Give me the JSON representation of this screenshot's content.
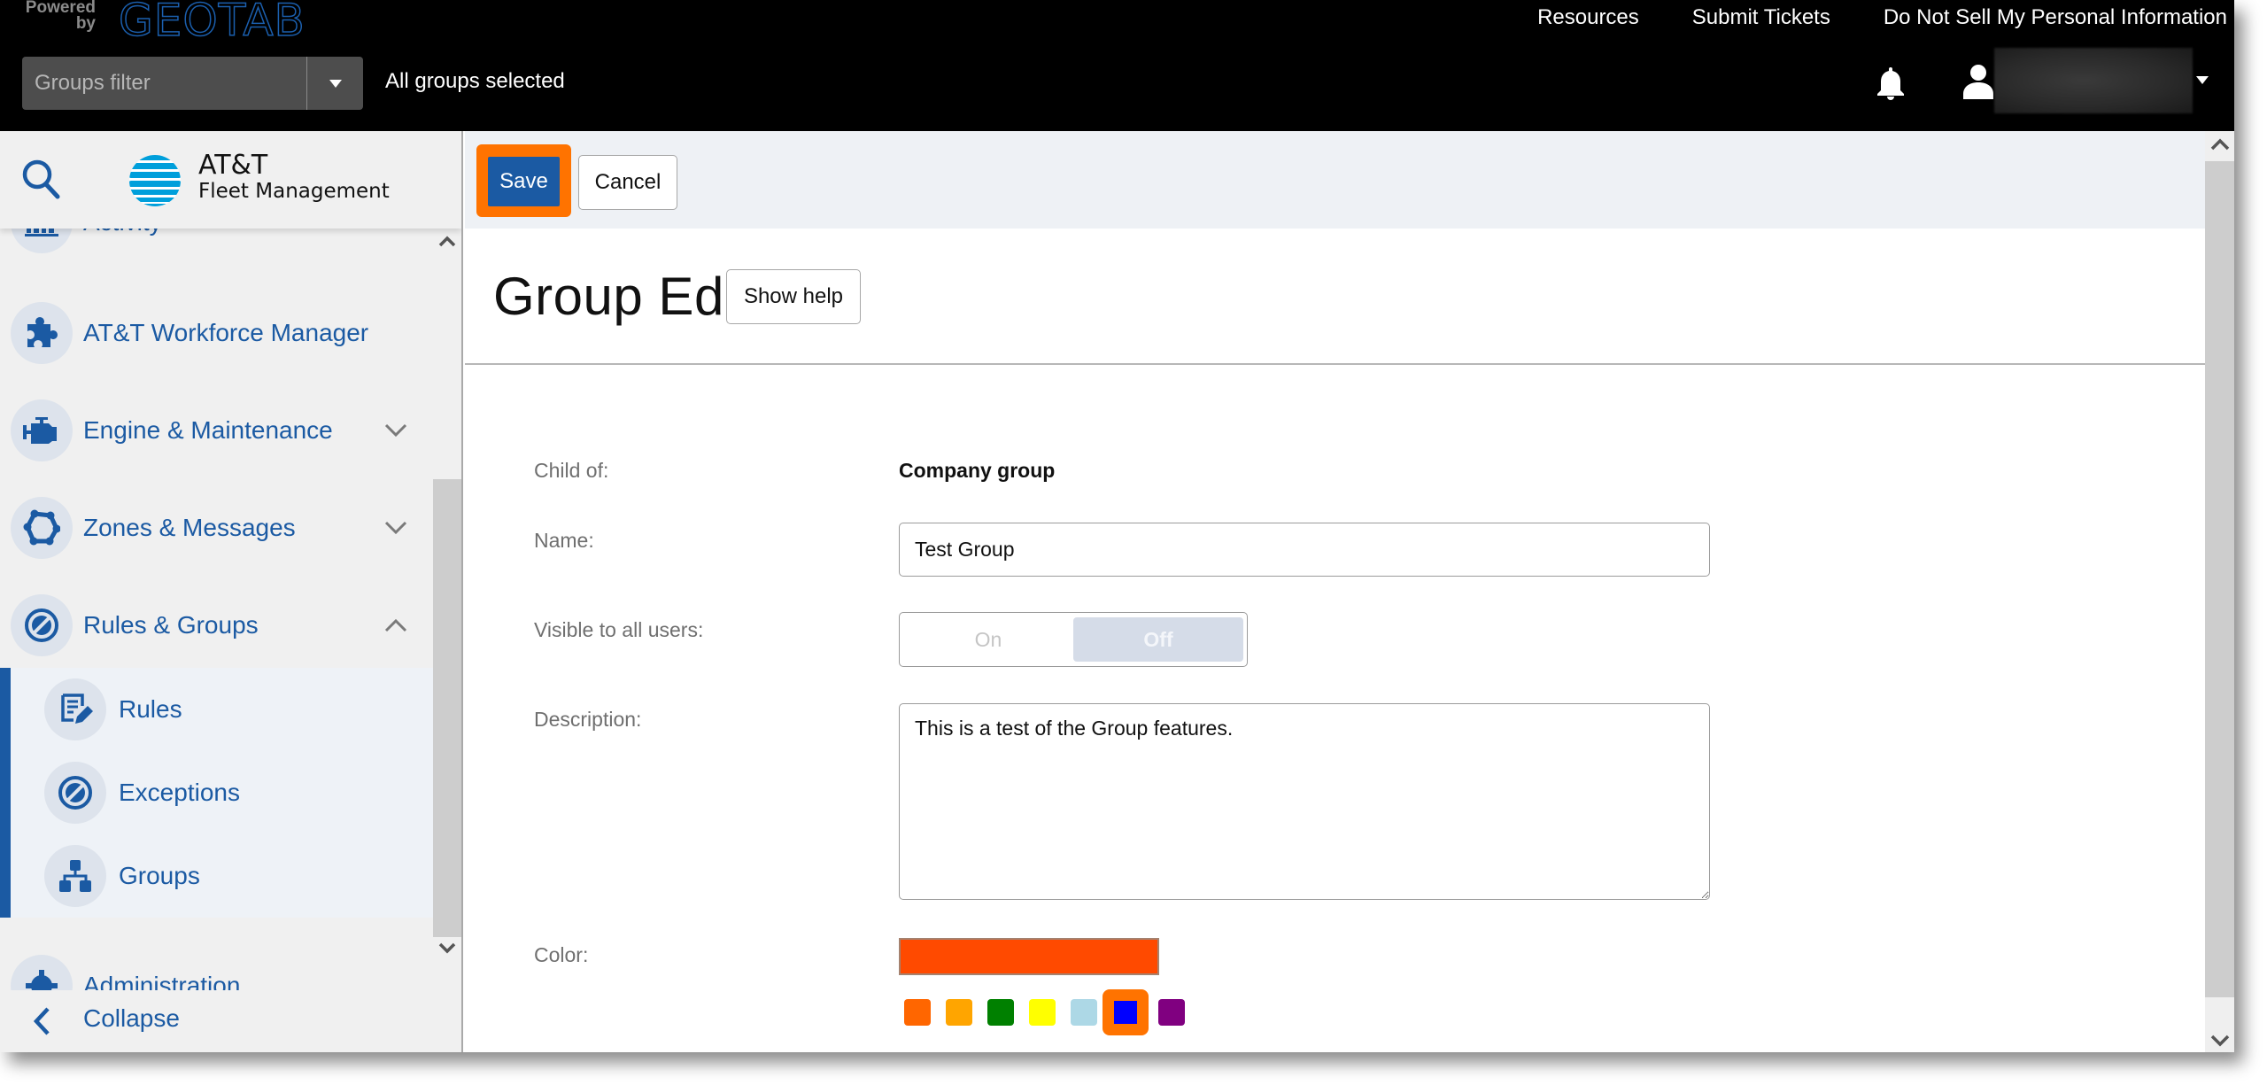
{
  "header": {
    "powered_by_line1": "Powered",
    "powered_by_line2": "by",
    "brand": "GEOTAB",
    "links": [
      "Resources",
      "Submit Tickets",
      "Do Not Sell My Personal Information"
    ],
    "groups_filter_placeholder": "Groups filter",
    "groups_selected_text": "All groups selected",
    "icons": {
      "notifications": "bell-icon",
      "user": "user-icon",
      "user_menu": "caret-down-icon"
    }
  },
  "sidebar": {
    "logo_line1": "AT&T",
    "logo_line2": "Fleet Management",
    "items": [
      {
        "label": "Activity",
        "icon": "bar-chart-icon",
        "expanded": false
      },
      {
        "label": "AT&T Workforce Manager",
        "icon": "puzzle-icon"
      },
      {
        "label": "Engine & Maintenance",
        "icon": "engine-icon",
        "expanded": false
      },
      {
        "label": "Zones & Messages",
        "icon": "zones-icon",
        "expanded": false
      },
      {
        "label": "Rules & Groups",
        "icon": "rules-icon",
        "expanded": true,
        "children": [
          {
            "label": "Rules",
            "icon": "rules-edit-icon"
          },
          {
            "label": "Exceptions",
            "icon": "exceptions-icon"
          },
          {
            "label": "Groups",
            "icon": "groups-icon"
          }
        ]
      },
      {
        "label": "Administration",
        "icon": "gear-icon",
        "expanded": false
      }
    ],
    "collapse_label": "Collapse"
  },
  "toolbar": {
    "save_label": "Save",
    "cancel_label": "Cancel"
  },
  "page": {
    "title": "Group Edit",
    "help_label": "Show help"
  },
  "form": {
    "child_of_label": "Child of:",
    "child_of_value": "Company group",
    "name_label": "Name:",
    "name_value": "Test Group",
    "visible_label": "Visible to all users:",
    "visible_on": "On",
    "visible_off": "Off",
    "visible_selected": "Off",
    "description_label": "Description:",
    "description_value": "This is a test of the Group features.",
    "color_label": "Color:",
    "current_color": "#ff4a00",
    "swatches": [
      "#ff6600",
      "#ffa500",
      "#008000",
      "#ffff00",
      "#add8e6",
      "#0000ff",
      "#800080"
    ],
    "selected_swatch_index": 5,
    "highlight_color": "#ff7300"
  },
  "colors": {
    "accent": "#1b5aa3",
    "topbar": "#000000",
    "highlight": "#ff7300"
  }
}
